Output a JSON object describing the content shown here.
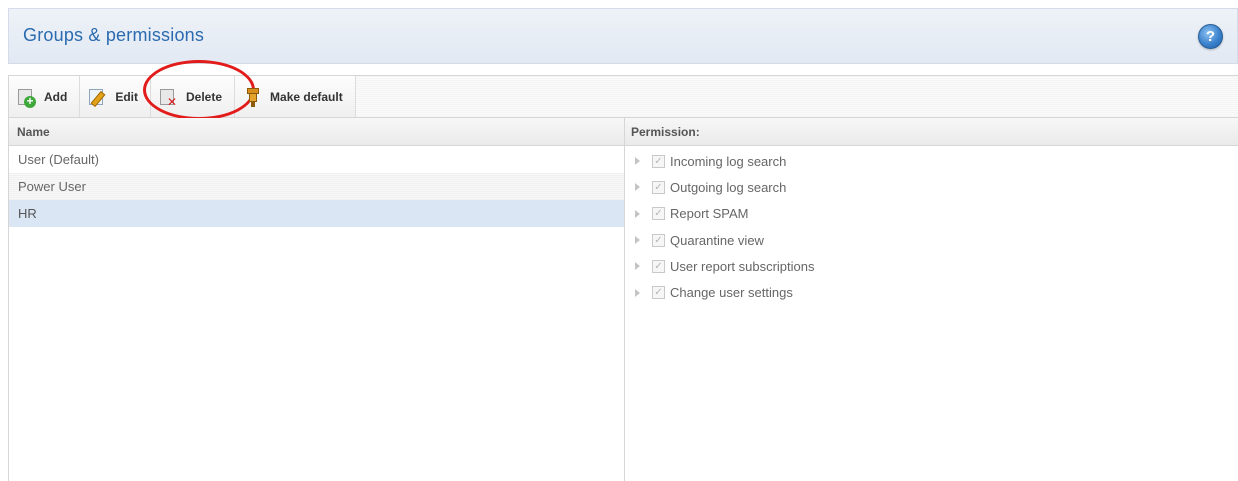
{
  "header": {
    "title": "Groups & permissions",
    "help_icon": "question-mark-icon",
    "help_glyph": "?"
  },
  "toolbar": {
    "add_label": "Add",
    "edit_label": "Edit",
    "delete_label": "Delete",
    "make_default_label": "Make default",
    "highlight_color": "#e21b1b"
  },
  "groups": {
    "header": "Name",
    "rows": [
      {
        "name": "User (Default)",
        "selected": false
      },
      {
        "name": "Power User",
        "selected": false
      },
      {
        "name": "HR",
        "selected": true
      }
    ]
  },
  "permissions": {
    "header": "Permission:",
    "check_glyph": "✓",
    "items": [
      {
        "label": "Incoming log search",
        "checked": true
      },
      {
        "label": "Outgoing log search",
        "checked": true
      },
      {
        "label": "Report SPAM",
        "checked": true
      },
      {
        "label": "Quarantine view",
        "checked": true
      },
      {
        "label": "User report subscriptions",
        "checked": true
      },
      {
        "label": "Change user settings",
        "checked": true
      }
    ]
  },
  "colors": {
    "title": "#2a6bb0",
    "selected_row": "#dae6f4"
  }
}
